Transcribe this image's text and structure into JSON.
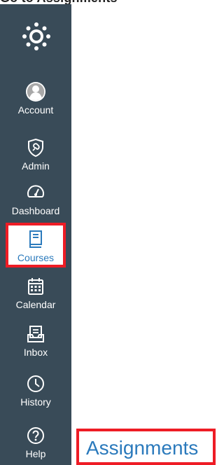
{
  "header": {
    "partial_title": "Go to Assignments"
  },
  "sidebar": {
    "logo_icon": "canvas-logo-icon",
    "items": [
      {
        "key": "account",
        "label": "Account",
        "icon": "user-avatar-icon"
      },
      {
        "key": "admin",
        "label": "Admin",
        "icon": "shield-icon"
      },
      {
        "key": "dashboard",
        "label": "Dashboard",
        "icon": "speedometer-icon"
      },
      {
        "key": "courses",
        "label": "Courses",
        "icon": "book-icon",
        "active": true
      },
      {
        "key": "calendar",
        "label": "Calendar",
        "icon": "calendar-icon"
      },
      {
        "key": "inbox",
        "label": "Inbox",
        "icon": "inbox-icon"
      },
      {
        "key": "history",
        "label": "History",
        "icon": "clock-icon"
      },
      {
        "key": "help",
        "label": "Help",
        "icon": "help-icon"
      }
    ]
  },
  "main": {
    "assignments_link": "Assignments"
  },
  "colors": {
    "sidebar_bg": "#394b58",
    "highlight_red": "#ee1c25",
    "link_blue": "#2b7abc"
  }
}
